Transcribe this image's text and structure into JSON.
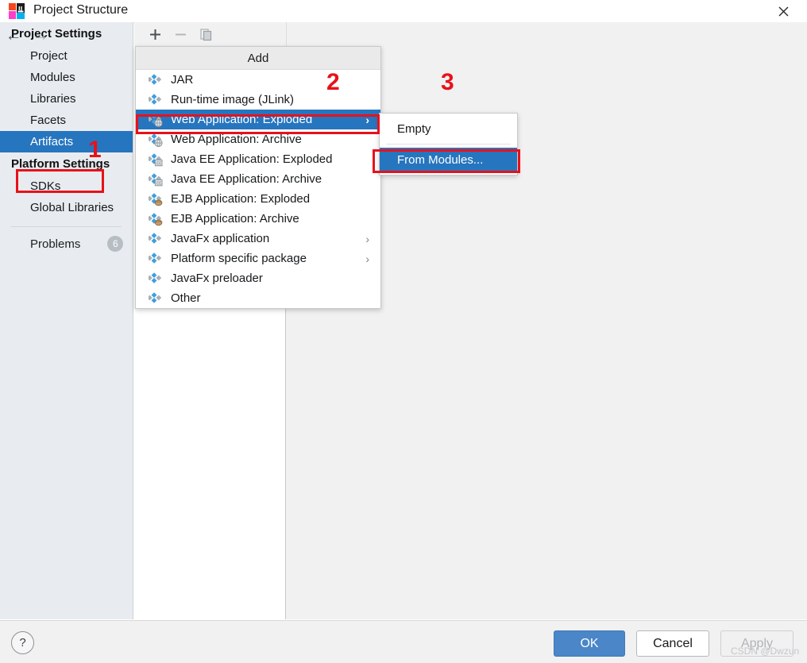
{
  "window": {
    "title": "Project Structure",
    "logo_icon": "intellij-idea-logo",
    "close_icon": "close-icon"
  },
  "sidebar": {
    "back_icon": "arrow-left-icon",
    "forward_icon": "arrow-right-icon",
    "groups": [
      {
        "label": "Project Settings",
        "items": [
          {
            "label": "Project",
            "selected": false
          },
          {
            "label": "Modules",
            "selected": false
          },
          {
            "label": "Libraries",
            "selected": false
          },
          {
            "label": "Facets",
            "selected": false
          },
          {
            "label": "Artifacts",
            "selected": true
          }
        ]
      },
      {
        "label": "Platform Settings",
        "items": [
          {
            "label": "SDKs",
            "selected": false
          },
          {
            "label": "Global Libraries",
            "selected": false
          }
        ]
      }
    ],
    "problems": {
      "label": "Problems",
      "count": "6"
    }
  },
  "toolbar": {
    "add_icon": "plus-icon",
    "remove_icon": "minus-icon",
    "copy_icon": "copy-icon"
  },
  "add_menu": {
    "header": "Add",
    "items": [
      {
        "label": "JAR",
        "icon": "artifact-jar-icon",
        "arrow": "",
        "selected": false
      },
      {
        "label": "Run-time image (JLink)",
        "icon": "artifact-runtime-image-icon",
        "arrow": "",
        "selected": false
      },
      {
        "label": "Web Application: Exploded",
        "icon": "artifact-web-exploded-icon",
        "arrow": "›",
        "selected": true
      },
      {
        "label": "Web Application: Archive",
        "icon": "artifact-web-archive-icon",
        "arrow": "",
        "selected": false
      },
      {
        "label": "Java EE Application: Exploded",
        "icon": "artifact-javaee-exploded-icon",
        "arrow": "",
        "selected": false
      },
      {
        "label": "Java EE Application: Archive",
        "icon": "artifact-javaee-archive-icon",
        "arrow": "",
        "selected": false
      },
      {
        "label": "EJB Application: Exploded",
        "icon": "artifact-ejb-exploded-icon",
        "arrow": "",
        "selected": false
      },
      {
        "label": "EJB Application: Archive",
        "icon": "artifact-ejb-archive-icon",
        "arrow": "",
        "selected": false
      },
      {
        "label": "JavaFx application",
        "icon": "artifact-javafx-icon",
        "arrow": "›",
        "selected": false
      },
      {
        "label": "Platform specific package",
        "icon": "artifact-platform-package-icon",
        "arrow": "›",
        "selected": false
      },
      {
        "label": "JavaFx preloader",
        "icon": "artifact-javafx-preloader-icon",
        "arrow": "",
        "selected": false
      },
      {
        "label": "Other",
        "icon": "artifact-other-icon",
        "arrow": "",
        "selected": false
      }
    ]
  },
  "submenu": {
    "items": [
      {
        "label": "Empty",
        "selected": false
      },
      {
        "label": "From Modules...",
        "selected": true
      }
    ]
  },
  "annotations": [
    {
      "number": "1"
    },
    {
      "number": "2"
    },
    {
      "number": "3"
    }
  ],
  "footer": {
    "help_label": "?",
    "ok_label": "OK",
    "cancel_label": "Cancel",
    "apply_label": "Apply"
  },
  "watermark": "CSDN @Dwzun",
  "colors": {
    "selection_blue": "#2675bf",
    "annotation_red": "#e8111a",
    "sidebar_bg": "#e8ecf0",
    "ok_button": "#4a86c8"
  }
}
